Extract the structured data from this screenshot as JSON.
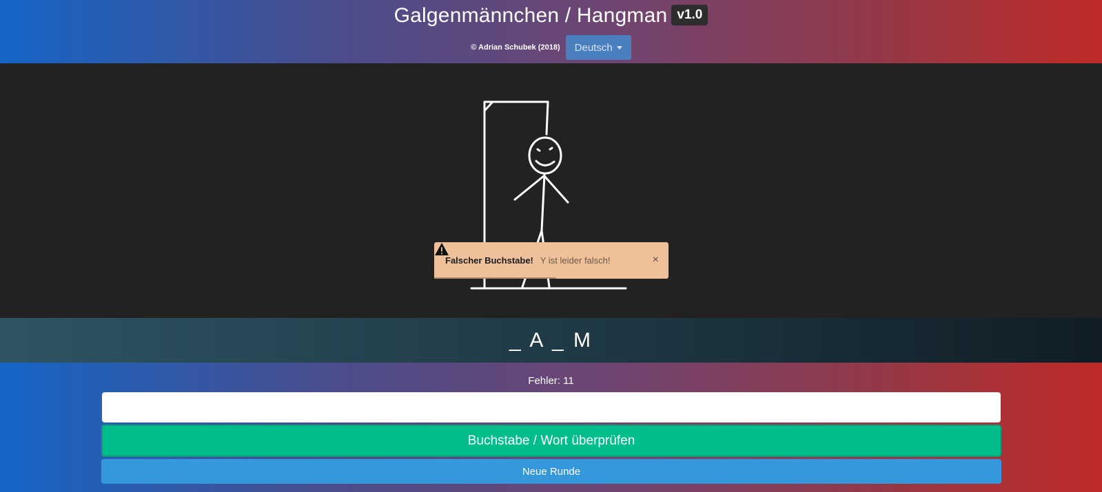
{
  "header": {
    "title": "Galgenmännchen / Hangman",
    "version": "v1.0",
    "copyright": "© Adrian Schubek (2018)",
    "language": "Deutsch"
  },
  "alert": {
    "title": "Falscher Buchstabe!",
    "message": "Y ist leider falsch!",
    "close": "×",
    "icon": "warning-icon",
    "timer_remaining": 0.52
  },
  "game": {
    "word_display": "_ A _ M",
    "errors_label": "Fehler: 11",
    "input_value": "",
    "input_placeholder": ""
  },
  "buttons": {
    "check": "Buchstabe / Wort überprüfen",
    "new_round": "Neue Runde"
  },
  "colors": {
    "gradient_start": "#1565c7",
    "gradient_end": "#bf2a27",
    "stage_background": "#222222",
    "alert_background": "#efc19b",
    "check_button": "#00bd8c",
    "new_round_button": "#3498db"
  }
}
